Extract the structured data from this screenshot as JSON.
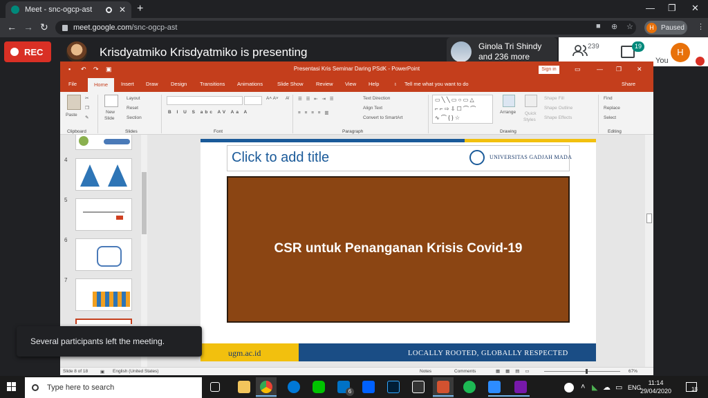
{
  "browser": {
    "tab_title": "Meet - snc-ogcp-ast",
    "url_host": "meet.google.com",
    "url_path": "/snc-ogcp-ast",
    "profile_initial": "H",
    "profile_status": "Paused"
  },
  "meet": {
    "rec_label": "REC",
    "presenting_text": "Krisdyatmiko Krisdyatmiko is presenting",
    "others_line1": "Ginola Tri Shindy",
    "others_line2": "and 236 more",
    "participant_count": "239",
    "chat_badge": "19",
    "you_initial": "H",
    "you_label": "You"
  },
  "ppt": {
    "window_title": "Presentasi Kris Seminar Daring PSdK  -  PowerPoint",
    "signin_label": "Sign in",
    "tabs": [
      "File",
      "Home",
      "Insert",
      "Draw",
      "Design",
      "Transitions",
      "Animations",
      "Slide Show",
      "Review",
      "View",
      "Help"
    ],
    "tell_me": "Tell me what you want to do",
    "share": "Share",
    "groups": {
      "clipboard": "Clipboard",
      "slides": "Slides",
      "font": "Font",
      "paragraph": "Paragraph",
      "drawing": "Drawing",
      "editing": "Editing"
    },
    "ribbon_labels": {
      "paste": "Paste",
      "new_slide_1": "New",
      "new_slide_2": "Slide",
      "layout": "Layout",
      "reset": "Reset",
      "section": "Section",
      "text_direction": "Text Direction",
      "align_text": "Align Text",
      "convert_smartart": "Convert to SmartArt",
      "arrange": "Arrange",
      "quick_styles_1": "Quick",
      "quick_styles_2": "Styles",
      "shape_fill": "Shape Fill",
      "shape_outline": "Shape Outline",
      "shape_effects": "Shape Effects",
      "find": "Find",
      "replace": "Replace",
      "select": "Select"
    },
    "thumb_numbers": [
      "4",
      "5",
      "6",
      "7"
    ],
    "slide": {
      "title_placeholder": "Click to add title",
      "university": "UNIVERSITAS GADJAH MADA",
      "main_text": "CSR untuk Penanganan Krisis Covid-19",
      "url": "ugm.ac.id",
      "motto": "LOCALLY ROOTED, GLOBALLY RESPECTED"
    },
    "status": {
      "slide_of": "Slide 8 of 18",
      "language": "English (United States)",
      "notes": "Notes",
      "comments": "Comments",
      "zoom": "67%"
    }
  },
  "toast": "Several participants left the meeting.",
  "taskbar": {
    "search_placeholder": "Type here to search",
    "mail_badge": "6",
    "lang": "ENG",
    "time": "11:14",
    "date": "29/04/2020",
    "notif_count": "18"
  }
}
